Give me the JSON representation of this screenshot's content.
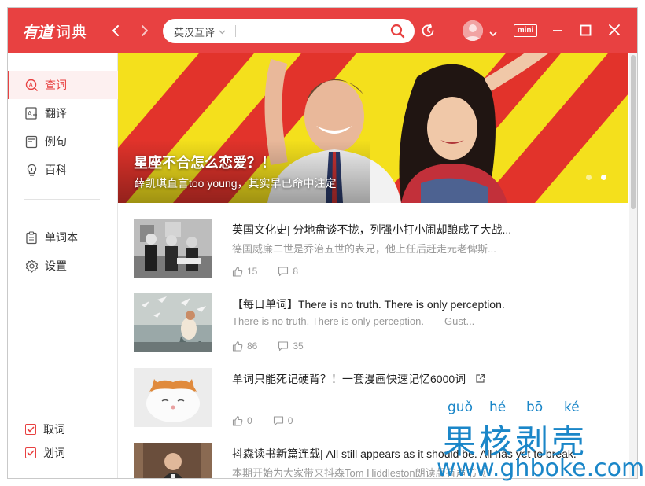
{
  "app": {
    "logo_mark": "有道",
    "logo_text": "词典"
  },
  "search": {
    "lang_mode": "英汉互译",
    "placeholder": "",
    "value": ""
  },
  "toolbar": {
    "mini_label": "mini"
  },
  "sidebar": {
    "items": [
      {
        "label": "查词",
        "icon": "search-word-icon",
        "active": true
      },
      {
        "label": "翻译",
        "icon": "translate-icon",
        "active": false
      },
      {
        "label": "例句",
        "icon": "example-sentence-icon",
        "active": false
      },
      {
        "label": "百科",
        "icon": "encyclopedia-icon",
        "active": false
      }
    ],
    "items2": [
      {
        "label": "单词本",
        "icon": "wordbook-icon"
      },
      {
        "label": "设置",
        "icon": "settings-icon"
      }
    ],
    "checks": [
      {
        "label": "取词",
        "checked": true
      },
      {
        "label": "划词",
        "checked": true
      }
    ]
  },
  "banner": {
    "title": "星座不合怎么恋爱？！",
    "subtitle": "薛凯琪直言too young，其实早已命中注定",
    "slide_count": 2,
    "active_slide": 2
  },
  "feed": [
    {
      "title": "英国文化史| 分地盘谈不拢，列强小打小闹却酿成了大战...",
      "desc": "德国威廉二世是乔治五世的表兄，他上任后赶走元老俾斯...",
      "likes": "15",
      "comments": "8",
      "has_external": false
    },
    {
      "title": "【每日单词】There is no truth. There is only perception.",
      "desc": "There is no truth. There is only perception.——Gust...",
      "likes": "86",
      "comments": "35",
      "has_external": false
    },
    {
      "title": "单词只能死记硬背？！一套漫画快速记忆6000词",
      "desc": "",
      "likes": "0",
      "comments": "0",
      "has_external": true
    },
    {
      "title": "抖森读书新篇连载| All still appears as it should be. All has yet to break.",
      "desc": "本期开始为大家带来抖森Tom Hiddleston朗读版有声书《",
      "likes": "",
      "comments": "",
      "has_external": false
    }
  ],
  "watermark": {
    "pinyin": [
      "guǒ",
      "hé",
      "bō",
      "ké"
    ],
    "chars": "果核剥壳",
    "url": "www.ghboke.com"
  },
  "colors": {
    "brand": "#e84141",
    "watermark": "#1a86c8"
  }
}
